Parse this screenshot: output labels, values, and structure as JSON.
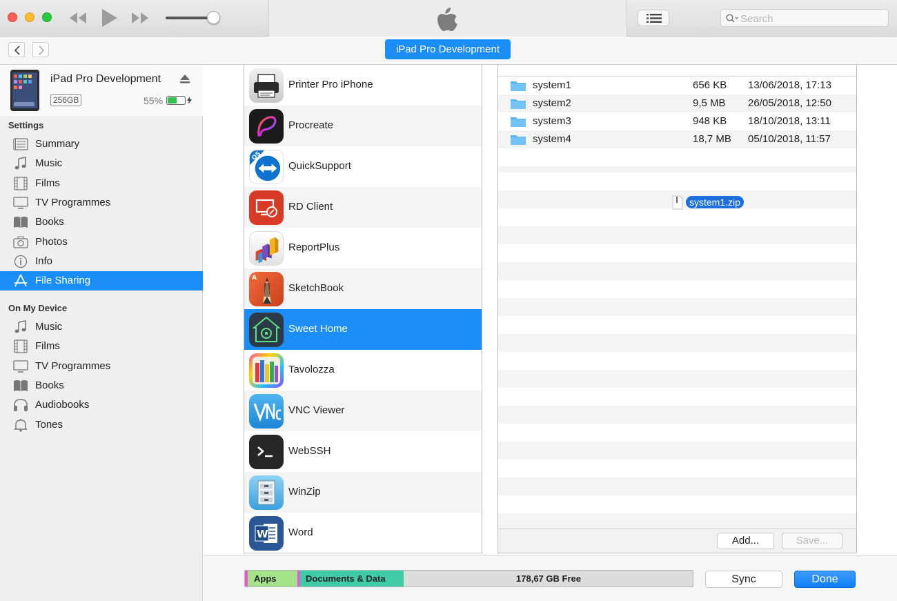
{
  "toolbar": {
    "search_placeholder": "Search"
  },
  "nav": {
    "device_tab": "iPad Pro Development"
  },
  "device": {
    "name": "iPad Pro Development",
    "capacity": "256GB",
    "battery": "55%",
    "battery_level": 0.55
  },
  "sidebar": {
    "settings_heading": "Settings",
    "settings_items": [
      {
        "label": "Summary",
        "icon": "summary-icon"
      },
      {
        "label": "Music",
        "icon": "music-icon"
      },
      {
        "label": "Films",
        "icon": "films-icon"
      },
      {
        "label": "TV Programmes",
        "icon": "tv-icon"
      },
      {
        "label": "Books",
        "icon": "books-icon"
      },
      {
        "label": "Photos",
        "icon": "camera-icon"
      },
      {
        "label": "Info",
        "icon": "info-icon"
      },
      {
        "label": "File Sharing",
        "icon": "file-sharing-icon",
        "selected": true
      }
    ],
    "device_heading": "On My Device",
    "device_items": [
      {
        "label": "Music",
        "icon": "music-icon"
      },
      {
        "label": "Films",
        "icon": "films-icon"
      },
      {
        "label": "TV Programmes",
        "icon": "tv-icon"
      },
      {
        "label": "Books",
        "icon": "books-icon"
      },
      {
        "label": "Audiobooks",
        "icon": "headphones-icon"
      },
      {
        "label": "Tones",
        "icon": "bell-icon"
      }
    ]
  },
  "apps": [
    {
      "name": "Printer Pro iPhone",
      "icon": "printer-app-icon"
    },
    {
      "name": "Procreate",
      "icon": "procreate-app-icon"
    },
    {
      "name": "QuickSupport",
      "icon": "quicksupport-app-icon"
    },
    {
      "name": "RD Client",
      "icon": "rd-client-app-icon"
    },
    {
      "name": "ReportPlus",
      "icon": "reportplus-app-icon"
    },
    {
      "name": "SketchBook",
      "icon": "sketchbook-app-icon"
    },
    {
      "name": "Sweet Home",
      "icon": "sweet-home-app-icon",
      "selected": true
    },
    {
      "name": "Tavolozza",
      "icon": "tavolozza-app-icon"
    },
    {
      "name": "VNC Viewer",
      "icon": "vnc-viewer-app-icon"
    },
    {
      "name": "WebSSH",
      "icon": "webssh-app-icon"
    },
    {
      "name": "WinZip",
      "icon": "winzip-app-icon"
    },
    {
      "name": "Word",
      "icon": "word-app-icon"
    }
  ],
  "files": [
    {
      "name": "system1",
      "size": "656 KB",
      "date": "13/06/2018, 17:13"
    },
    {
      "name": "system2",
      "size": "9,5 MB",
      "date": "26/05/2018, 12:50"
    },
    {
      "name": "system3",
      "size": "948 KB",
      "date": "18/10/2018, 13:11"
    },
    {
      "name": "system4",
      "size": "18,7 MB",
      "date": "05/10/2018, 11:57"
    }
  ],
  "drag_file": "system1.zip",
  "file_buttons": {
    "add": "Add...",
    "save": "Save..."
  },
  "capacity_bar": {
    "apps": "Apps",
    "documents": "Documents & Data",
    "free": "178,67 GB Free"
  },
  "actions": {
    "sync": "Sync",
    "done": "Done"
  },
  "colors": {
    "accent": "#1b8ef8",
    "apps_segment": "#a4e38c",
    "documents_segment": "#3ecba5",
    "pink_segment": "#e65bd3"
  }
}
